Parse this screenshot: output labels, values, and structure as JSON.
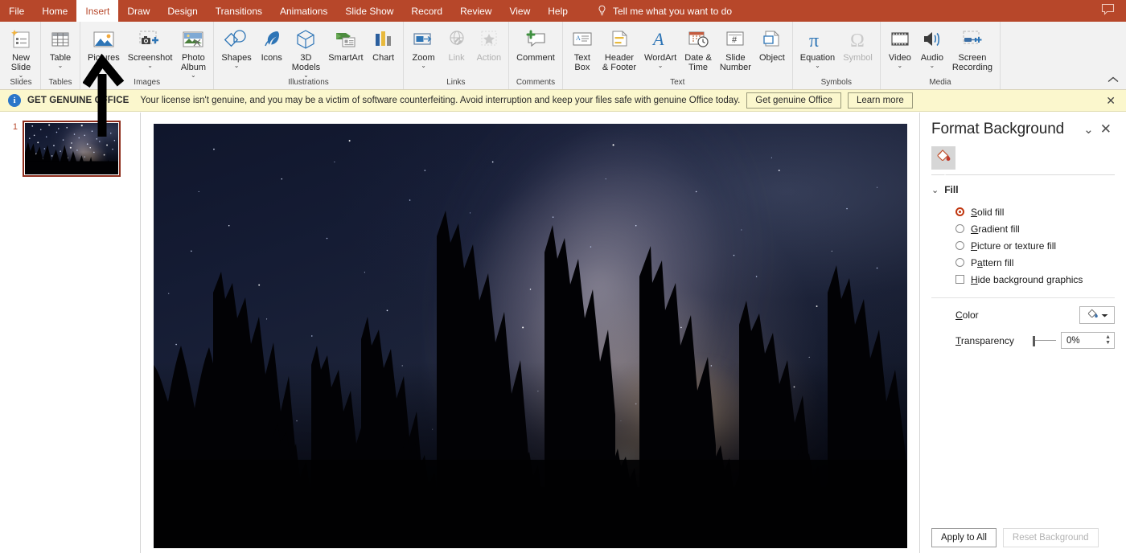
{
  "app": {
    "accent_color": "#b7472a",
    "notif_bg": "#fbf7cd"
  },
  "menubar": {
    "items": [
      {
        "label": "File",
        "active": false
      },
      {
        "label": "Home",
        "active": false
      },
      {
        "label": "Insert",
        "active": true
      },
      {
        "label": "Draw",
        "active": false
      },
      {
        "label": "Design",
        "active": false
      },
      {
        "label": "Transitions",
        "active": false
      },
      {
        "label": "Animations",
        "active": false
      },
      {
        "label": "Slide Show",
        "active": false
      },
      {
        "label": "Record",
        "active": false
      },
      {
        "label": "Review",
        "active": false
      },
      {
        "label": "View",
        "active": false
      },
      {
        "label": "Help",
        "active": false
      }
    ],
    "tellme": "Tell me what you want to do",
    "tellme_icon": "lightbulb-icon",
    "comment_icon": "comment-bubble-icon"
  },
  "ribbon": {
    "collapse_icon": "chevron-up-icon",
    "groups": [
      {
        "name": "Slides",
        "label": "Slides",
        "buttons": [
          {
            "label": "New\nSlide",
            "icon": "new-slide-icon",
            "caret": true,
            "disabled": false
          }
        ]
      },
      {
        "name": "Tables",
        "label": "Tables",
        "buttons": [
          {
            "label": "Table",
            "icon": "table-icon",
            "caret": true,
            "disabled": false
          }
        ]
      },
      {
        "name": "Images",
        "label": "Images",
        "buttons": [
          {
            "label": "Pictures",
            "icon": "pictures-icon",
            "caret": true,
            "disabled": false
          },
          {
            "label": "Screenshot",
            "icon": "screenshot-icon",
            "caret": true,
            "disabled": false
          },
          {
            "label": "Photo\nAlbum",
            "icon": "photo-album-icon",
            "caret": true,
            "disabled": false
          }
        ]
      },
      {
        "name": "Illustrations",
        "label": "Illustrations",
        "buttons": [
          {
            "label": "Shapes",
            "icon": "shapes-icon",
            "caret": true,
            "disabled": false
          },
          {
            "label": "Icons",
            "icon": "icons-icon",
            "caret": false,
            "disabled": false
          },
          {
            "label": "3D\nModels",
            "icon": "3d-models-icon",
            "caret": true,
            "disabled": false
          },
          {
            "label": "SmartArt",
            "icon": "smartart-icon",
            "caret": false,
            "disabled": false
          },
          {
            "label": "Chart",
            "icon": "chart-icon",
            "caret": false,
            "disabled": false
          }
        ]
      },
      {
        "name": "Links",
        "label": "Links",
        "buttons": [
          {
            "label": "Zoom",
            "icon": "zoom-icon",
            "caret": true,
            "disabled": false
          },
          {
            "label": "Link",
            "icon": "link-icon",
            "caret": false,
            "disabled": true
          },
          {
            "label": "Action",
            "icon": "action-icon",
            "caret": false,
            "disabled": true
          }
        ]
      },
      {
        "name": "Comments",
        "label": "Comments",
        "buttons": [
          {
            "label": "Comment",
            "icon": "comment-icon",
            "caret": false,
            "disabled": false
          }
        ]
      },
      {
        "name": "Text",
        "label": "Text",
        "buttons": [
          {
            "label": "Text\nBox",
            "icon": "text-box-icon",
            "caret": false,
            "disabled": false
          },
          {
            "label": "Header\n& Footer",
            "icon": "header-footer-icon",
            "caret": false,
            "disabled": false
          },
          {
            "label": "WordArt",
            "icon": "wordart-icon",
            "caret": true,
            "disabled": false
          },
          {
            "label": "Date &\nTime",
            "icon": "date-time-icon",
            "caret": false,
            "disabled": false
          },
          {
            "label": "Slide\nNumber",
            "icon": "slide-number-icon",
            "caret": false,
            "disabled": false
          },
          {
            "label": "Object",
            "icon": "object-icon",
            "caret": false,
            "disabled": false
          }
        ]
      },
      {
        "name": "Symbols",
        "label": "Symbols",
        "buttons": [
          {
            "label": "Equation",
            "icon": "equation-icon",
            "caret": true,
            "disabled": false
          },
          {
            "label": "Symbol",
            "icon": "symbol-icon",
            "caret": false,
            "disabled": true
          }
        ]
      },
      {
        "name": "Media",
        "label": "Media",
        "buttons": [
          {
            "label": "Video",
            "icon": "video-icon",
            "caret": true,
            "disabled": false
          },
          {
            "label": "Audio",
            "icon": "audio-icon",
            "caret": true,
            "disabled": false
          },
          {
            "label": "Screen\nRecording",
            "icon": "screen-recording-icon",
            "caret": false,
            "disabled": false
          }
        ]
      }
    ]
  },
  "notification": {
    "icon": "info-icon",
    "title": "GET GENUINE OFFICE",
    "message": "Your license isn't genuine, and you may be a victim of software counterfeiting. Avoid interruption and keep your files safe with genuine Office today.",
    "primary_button": "Get genuine Office",
    "secondary_button": "Learn more",
    "close_icon": "close-icon"
  },
  "thumbnails": {
    "slides": [
      {
        "number": "1",
        "selected": true
      }
    ]
  },
  "format_background": {
    "title": "Format Background",
    "collapse_icon": "chevron-down-icon",
    "close_icon": "close-icon",
    "tab_icon": "paint-bucket-icon",
    "section_label": "Fill",
    "section_chevron": "chevron-down-icon",
    "fill_options": [
      {
        "label": "Solid fill",
        "mnemonic": "S",
        "selected": true
      },
      {
        "label": "Gradient fill",
        "mnemonic": "G",
        "selected": false
      },
      {
        "label": "Picture or texture fill",
        "mnemonic": "P",
        "selected": false
      },
      {
        "label": "Pattern fill",
        "mnemonic": "a",
        "selected": false
      }
    ],
    "hide_background_graphics": {
      "label": "Hide background graphics",
      "checked": false
    },
    "color_label": "Color",
    "color_button_icon": "paint-bucket-icon",
    "color_dropdown_icon": "chevron-down-icon",
    "transparency_label": "Transparency",
    "transparency_value": "0%",
    "apply_to_all_button": "Apply to All",
    "reset_background_button": "Reset Background",
    "reset_background_disabled": true
  },
  "slide": {
    "content_description": "Night sky photograph with Milky Way over silhouetted pine trees"
  },
  "annotation": {
    "arrow": "black-up-arrow-pointing-to-pictures",
    "color": "#000000"
  }
}
